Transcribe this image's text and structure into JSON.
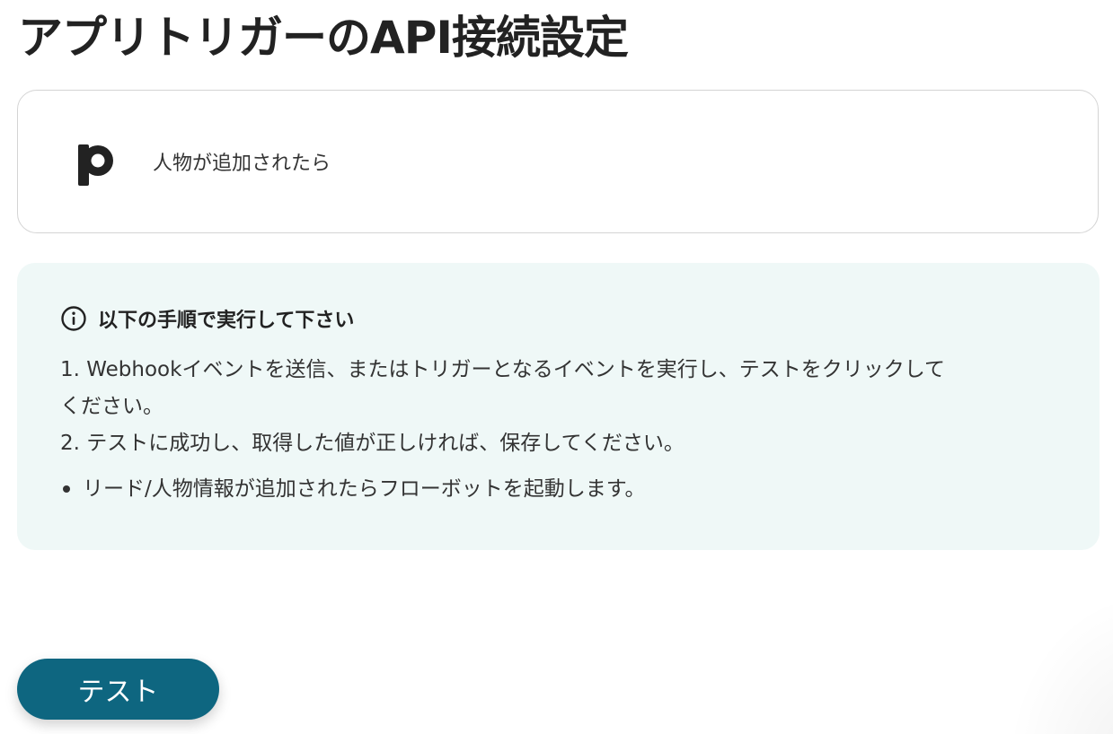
{
  "page": {
    "title": "アプリトリガーのAPI接続設定"
  },
  "trigger": {
    "app_logo_icon": "pipedrive-p-icon",
    "label": "人物が追加されたら"
  },
  "instructions": {
    "icon": "info-circle-icon",
    "heading": "以下の手順で実行して下さい",
    "steps": [
      "1. Webhookイベントを送信、またはトリガーとなるイベントを実行し、テストをクリックして",
      "ください。",
      "2. テストに成功し、取得した値が正しければ、保存してください。"
    ],
    "notes": [
      "リード/人物情報が追加されたらフローボットを起動します。"
    ]
  },
  "actions": {
    "test_label": "テスト"
  },
  "colors": {
    "primary_button": "#0e6680",
    "info_panel_bg": "#eff8f7",
    "card_border": "#d4d4d4",
    "text": "#222222"
  }
}
